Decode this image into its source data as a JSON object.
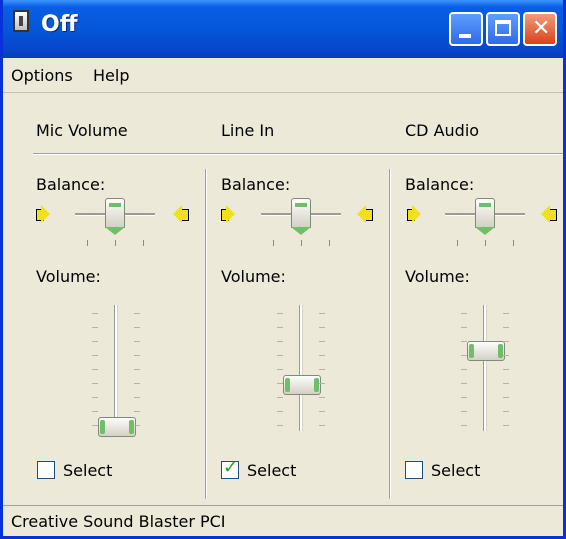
{
  "window": {
    "title": "Off"
  },
  "menu": {
    "options": "Options",
    "help": "Help"
  },
  "columns": [
    {
      "header": "Mic Volume",
      "balance_label": "Balance:",
      "volume_label": "Volume:",
      "balance": 0.5,
      "volume": 0.0,
      "select_label": "Select",
      "selected": false
    },
    {
      "header": "Line In",
      "balance_label": "Balance:",
      "volume_label": "Volume:",
      "balance": 0.5,
      "volume": 0.4,
      "select_label": "Select",
      "selected": true
    },
    {
      "header": "CD Audio",
      "balance_label": "Balance:",
      "volume_label": "Volume:",
      "balance": 0.5,
      "volume": 0.72,
      "select_label": "Select",
      "selected": false
    }
  ],
  "status": {
    "text": "Creative Sound Blaster PCI"
  },
  "colors": {
    "titlebar": "#0556d9",
    "accent_green": "#6fbf6a",
    "face": "#ece9d8"
  },
  "icons": {
    "speaker_left": "speaker-left-icon",
    "speaker_right": "speaker-right-icon",
    "check": "checkmark-icon"
  }
}
